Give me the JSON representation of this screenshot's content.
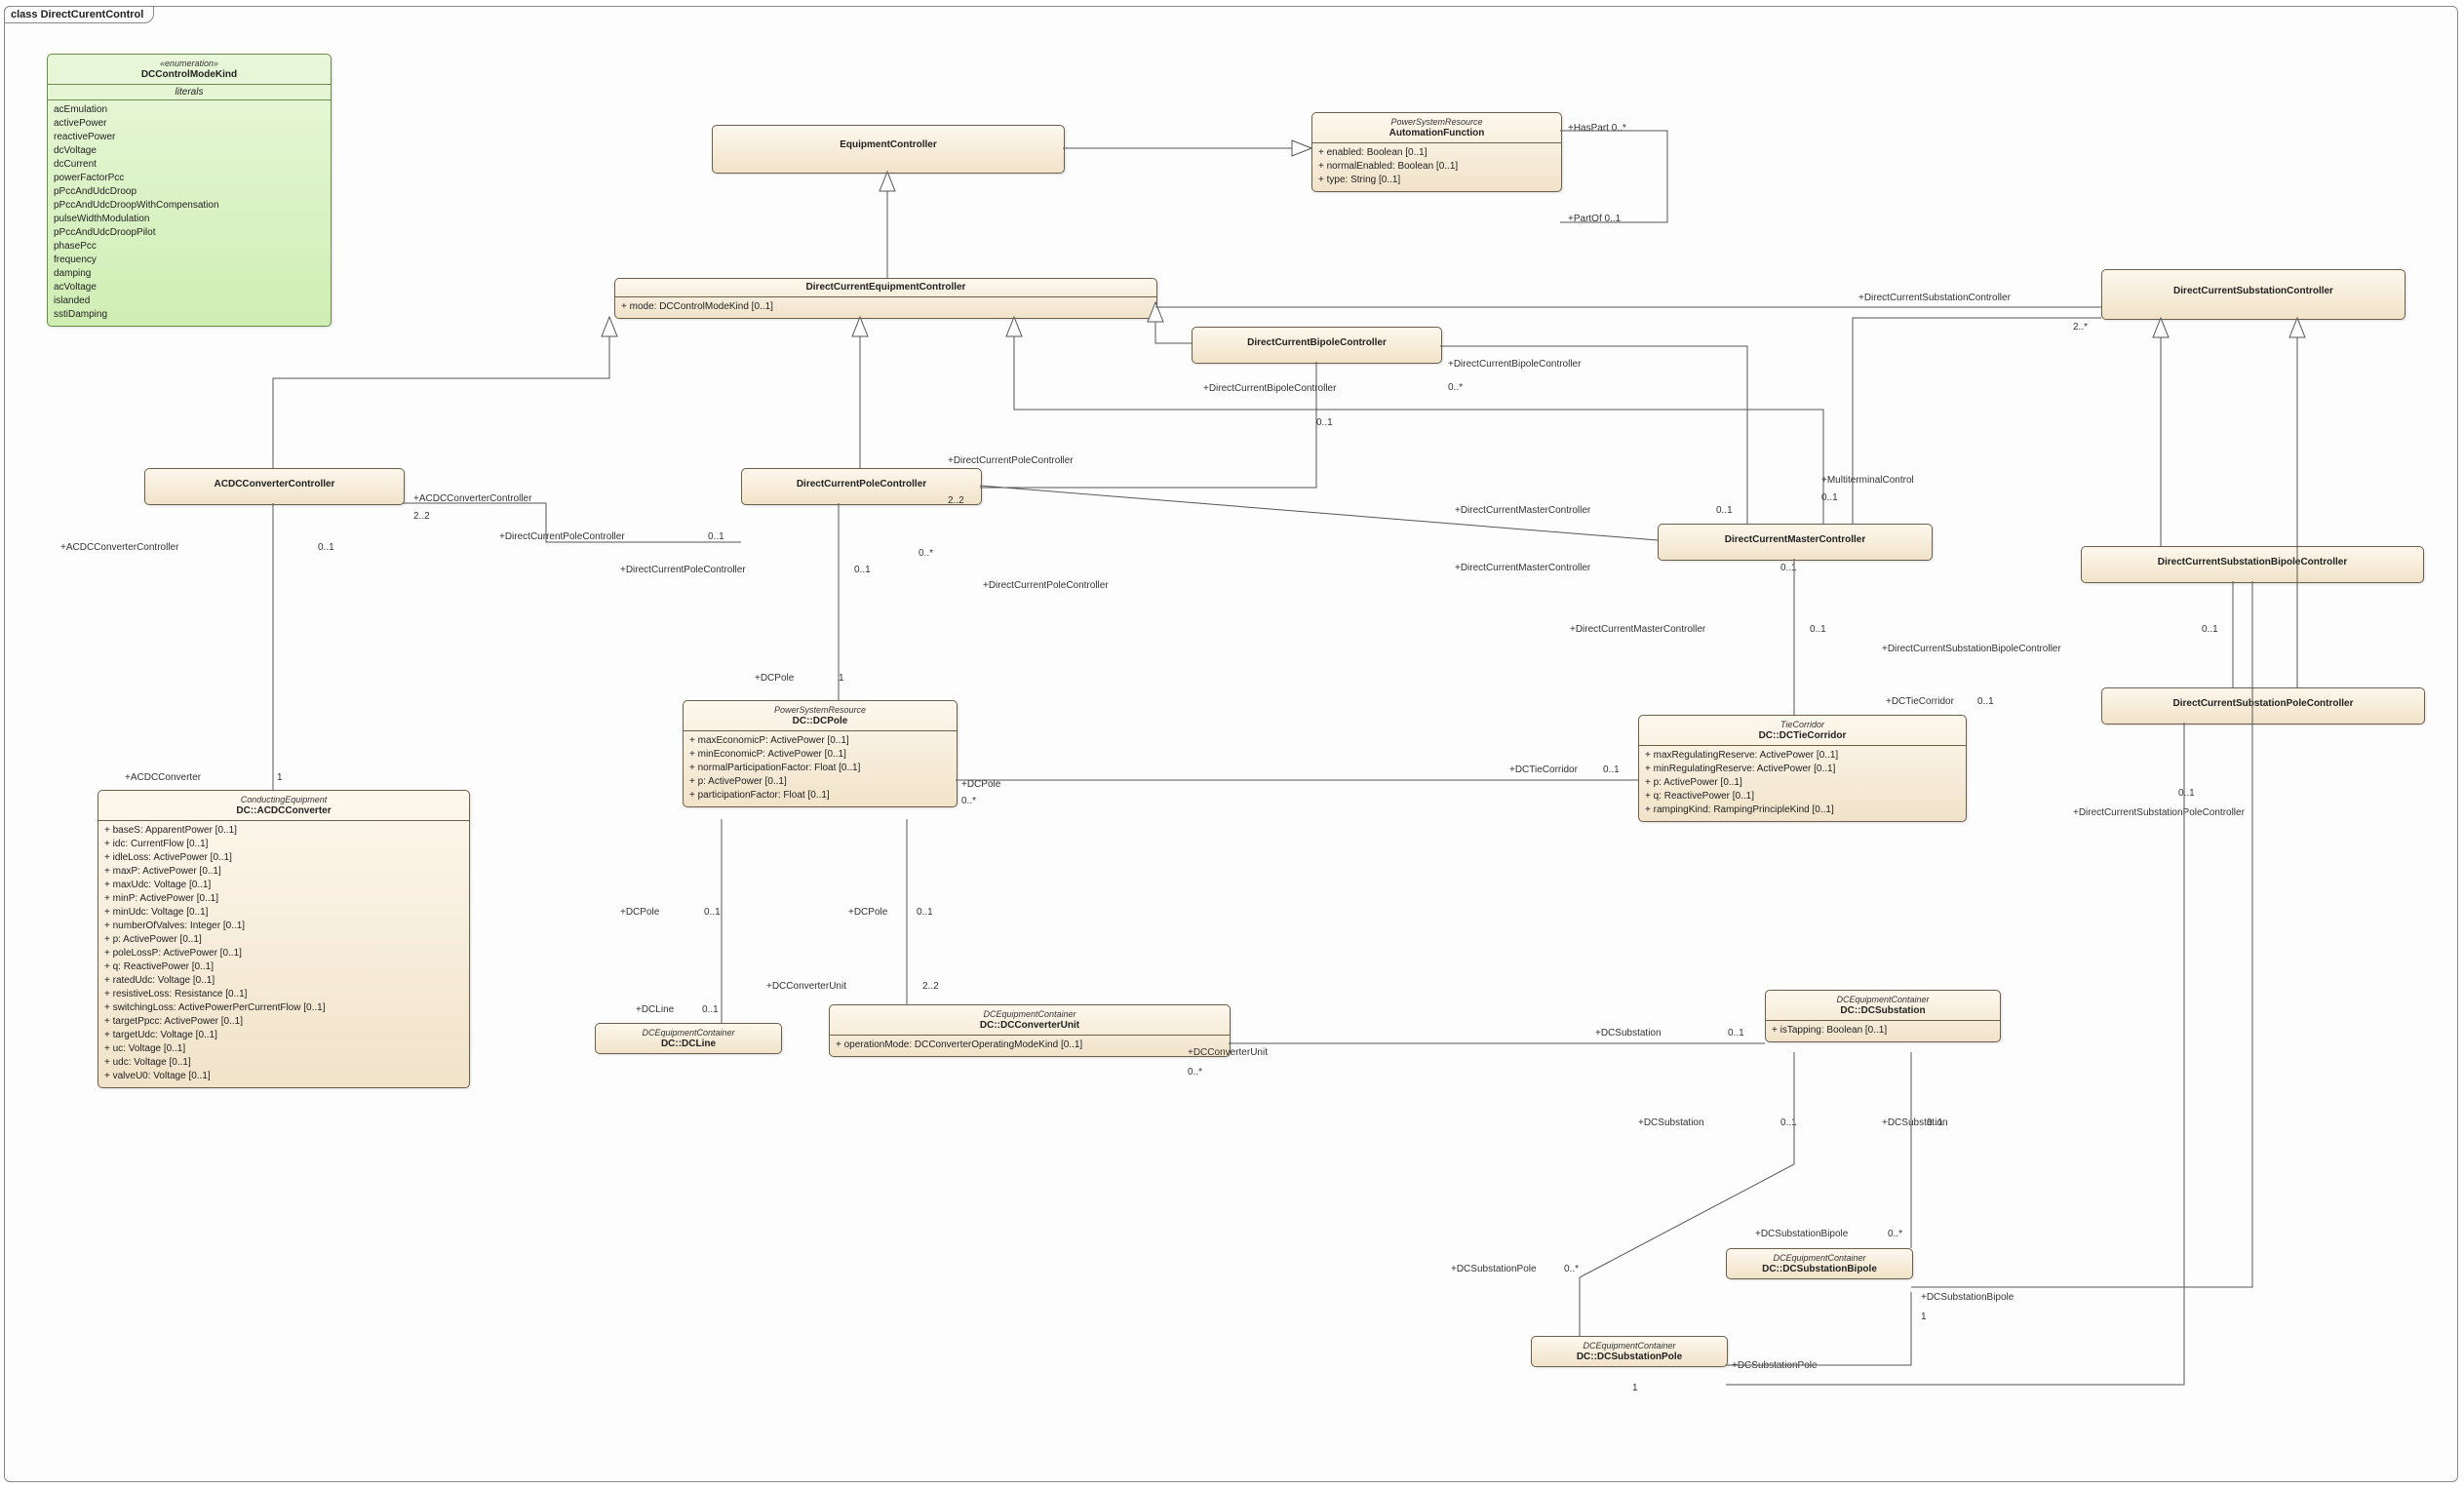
{
  "diagram": {
    "frame_label_kw": "class",
    "frame_label": "DirectCurentControl"
  },
  "enum_dcmode": {
    "stereo": "«enumeration»",
    "name": "DCControlModeKind",
    "literals_hdr": "literals",
    "literals": [
      "acEmulation",
      "activePower",
      "reactivePower",
      "dcVoltage",
      "dcCurrent",
      "powerFactorPcc",
      "pPccAndUdcDroop",
      "pPccAndUdcDroopWithCompensation",
      "pulseWidthModulation",
      "pPccAndUdcDroopPilot",
      "phasePcc",
      "frequency",
      "damping",
      "acVoltage",
      "islanded",
      "sstiDamping"
    ]
  },
  "cls": {
    "equipmentController": {
      "name": "EquipmentController"
    },
    "automationFunction": {
      "stereo": "PowerSystemResource",
      "name": "AutomationFunction",
      "attrs": [
        "+  enabled: Boolean [0..1]",
        "+  normalEnabled: Boolean [0..1]",
        "+  type: String [0..1]"
      ]
    },
    "dcec": {
      "name": "DirectCurrentEquipmentController",
      "attrs": [
        "+  mode: DCControlModeKind [0..1]"
      ]
    },
    "dcBipoleCtrl": {
      "name": "DirectCurrentBipoleController"
    },
    "dcSubCtrl": {
      "name": "DirectCurrentSubstationController"
    },
    "acdcCtrl": {
      "name": "ACDCConverterController"
    },
    "dcPoleCtrl": {
      "name": "DirectCurrentPoleController"
    },
    "dcMasterCtrl": {
      "name": "DirectCurrentMasterController"
    },
    "dcSubBipoleCtrl": {
      "name": "DirectCurrentSubstationBipoleController"
    },
    "dcSubPoleCtrl": {
      "name": "DirectCurrentSubstationPoleController"
    },
    "acdcConv": {
      "stereo": "ConductingEquipment",
      "name": "DC::ACDCConverter",
      "attrs": [
        "+  baseS: ApparentPower [0..1]",
        "+  idc: CurrentFlow [0..1]",
        "+  idleLoss: ActivePower [0..1]",
        "+  maxP: ActivePower [0..1]",
        "+  maxUdc: Voltage [0..1]",
        "+  minP: ActivePower [0..1]",
        "+  minUdc: Voltage [0..1]",
        "+  numberOfValves: Integer [0..1]",
        "+  p: ActivePower [0..1]",
        "+  poleLossP: ActivePower [0..1]",
        "+  q: ReactivePower [0..1]",
        "+  ratedUdc: Voltage [0..1]",
        "+  resistiveLoss: Resistance [0..1]",
        "+  switchingLoss: ActivePowerPerCurrentFlow [0..1]",
        "+  targetPpcc: ActivePower [0..1]",
        "+  targetUdc: Voltage [0..1]",
        "+  uc: Voltage [0..1]",
        "+  udc: Voltage [0..1]",
        "+  valveU0: Voltage [0..1]"
      ]
    },
    "dcPole": {
      "stereo": "PowerSystemResource",
      "name": "DC::DCPole",
      "attrs": [
        "+  maxEconomicP: ActivePower [0..1]",
        "+  minEconomicP: ActivePower [0..1]",
        "+  normalParticipationFactor: Float [0..1]",
        "+  p: ActivePower [0..1]",
        "+  participationFactor: Float [0..1]"
      ]
    },
    "dcTie": {
      "stereo": "TieCorridor",
      "name": "DC::DCTieCorridor",
      "attrs": [
        "+  maxRegulatingReserve: ActivePower [0..1]",
        "+  minRegulatingReserve: ActivePower [0..1]",
        "+  p: ActivePower [0..1]",
        "+  q: ReactivePower [0..1]",
        "+  rampingKind: RampingPrincipleKind [0..1]"
      ]
    },
    "dcLine": {
      "stereo": "DCEquipmentContainer",
      "name": "DC::DCLine"
    },
    "dcConvUnit": {
      "stereo": "DCEquipmentContainer",
      "name": "DC::DCConverterUnit",
      "attrs": [
        "+  operationMode: DCConverterOperatingModeKind [0..1]"
      ]
    },
    "dcSubstation": {
      "stereo": "DCEquipmentContainer",
      "name": "DC::DCSubstation",
      "attrs": [
        "+  isTapping: Boolean [0..1]"
      ]
    },
    "dcSubBipole": {
      "stereo": "DCEquipmentContainer",
      "name": "DC::DCSubstationBipole"
    },
    "dcSubPole": {
      "stereo": "DCEquipmentContainer",
      "name": "DC::DCSubstationPole"
    }
  },
  "roles": {
    "hasPart": "+HasPart 0..*",
    "partOf": "+PartOf 0..1",
    "dcSubCtrl": "+DirectCurrentSubstationController",
    "dcSubCtrl_m": "2..*",
    "acdcCtrl_self": "+ACDCConverterController",
    "acdcCtrl_m0": "0..1",
    "acdcCtrl_m22": "2..2",
    "acdcConv": "+ACDCConverter",
    "acdcConv_m1": "1",
    "dcPoleCtrl": "+DirectCurrentPoleController",
    "dcPoleCtrl_m01": "0..1",
    "dcPoleCtrl_m22": "2..2",
    "dcPoleCtrl_m0s": "0..*",
    "dcBipoleCtrl": "+DirectCurrentBipoleController",
    "dcBipoleCtrl_m01": "0..1",
    "dcBipoleCtrl_m0s": "0..*",
    "dcMasterCtrl": "+DirectCurrentMasterController",
    "dcMasterCtrl_m01": "0..1",
    "multiCtrl": "+MultiterminalControl",
    "multiCtrl_m01": "0..1",
    "dcSubBipoleCtrl": "+DirectCurrentSubstationBipoleController",
    "dcSubBipoleCtrl_m01": "0..1",
    "dcSubPoleCtrl": "+DirectCurrentSubstationPoleController",
    "dcSubPoleCtrl_m01": "0..1",
    "dcPole": "+DCPole",
    "dcPole_m1": "1",
    "dcPole_m01": "0..1",
    "dcPole_m0s": "0..*",
    "dcTie": "+DCTieCorridor",
    "dcTie_m01": "0..1",
    "dcLine": "+DCLine",
    "dcLine_m01": "0..1",
    "dcConvUnit": "+DCConverterUnit",
    "dcConvUnit_m22": "2..2",
    "dcConvUnit_m0s": "0..*",
    "dcSubstation": "+DCSubstation",
    "dcSubstation_m01": "0..1",
    "dcSubBipole": "+DCSubstationBipole",
    "dcSubBipole_m0s": "0..*",
    "dcSubBipole_m1": "1",
    "dcSubPole": "+DCSubstationPole",
    "dcSubPole_m0s": "0..*",
    "dcSubPole_m1": "1"
  }
}
